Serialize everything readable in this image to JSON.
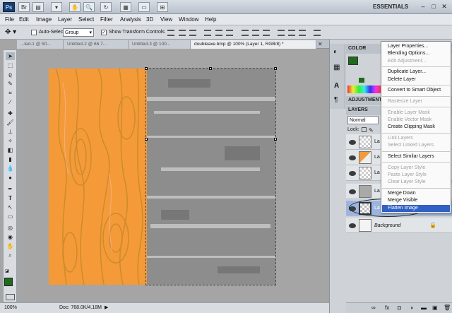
{
  "app": {
    "logo": "Ps",
    "workspace": "ESSENTIALS",
    "window_controls": [
      "–",
      "□",
      "✕"
    ]
  },
  "menubar": {
    "items": [
      "File",
      "Edit",
      "Image",
      "Layer",
      "Select",
      "Filter",
      "Analysis",
      "3D",
      "View",
      "Window",
      "Help"
    ]
  },
  "options": {
    "auto_select_label": "Auto-Select:",
    "auto_select_value": "Group",
    "transform_label": "Show Transform Controls"
  },
  "tabs": [
    {
      "label": "...led-1 @ 50...",
      "active": false
    },
    {
      "label": "Untitled-2 @ 66.7...",
      "active": false
    },
    {
      "label": "Untitled-3 @ 100...",
      "active": false
    },
    {
      "label": "doubleaxe.bmp @ 100% (Layer 1, RGB/8) *",
      "active": true
    }
  ],
  "status": {
    "zoom": "100%",
    "doc": "Doc: 768.0K/4.18M"
  },
  "panels": {
    "color_tab": "COLOR",
    "adjustments_tab": "ADJUSTMENT",
    "layers_tab": "LAYERS",
    "blend_mode": "Normal",
    "lock_label": "Lock:",
    "layer_prefix": "La",
    "background_label": "Background"
  },
  "context_menu": {
    "groups": [
      [
        {
          "label": "Layer Properties...",
          "enabled": true
        },
        {
          "label": "Blending Options...",
          "enabled": true
        },
        {
          "label": "Edit Adjustment...",
          "enabled": false
        }
      ],
      [
        {
          "label": "Duplicate Layer...",
          "enabled": true
        },
        {
          "label": "Delete Layer",
          "enabled": true
        }
      ],
      [
        {
          "label": "Convert to Smart Object",
          "enabled": true
        }
      ],
      [
        {
          "label": "Rasterize Layer",
          "enabled": false
        }
      ],
      [
        {
          "label": "Enable Layer Mask",
          "enabled": false
        },
        {
          "label": "Enable Vector Mask",
          "enabled": false
        },
        {
          "label": "Create Clipping Mask",
          "enabled": true
        }
      ],
      [
        {
          "label": "Link Layers",
          "enabled": false
        },
        {
          "label": "Select Linked Layers",
          "enabled": false
        }
      ],
      [
        {
          "label": "Select Similar Layers",
          "enabled": true
        }
      ],
      [
        {
          "label": "Copy Layer Style",
          "enabled": false
        },
        {
          "label": "Paste Layer Style",
          "enabled": false
        },
        {
          "label": "Clear Layer Style",
          "enabled": false
        }
      ],
      [
        {
          "label": "Merge Down",
          "enabled": true
        },
        {
          "label": "Merge Visible",
          "enabled": true
        },
        {
          "label": "Flatten Image",
          "enabled": true,
          "highlighted": true
        }
      ]
    ]
  },
  "colors": {
    "accent": "#3161c5",
    "foreground_swatch": "#1f6a1d",
    "orange": "#f49a39"
  },
  "icons": [
    "photoshop-logo-icon",
    "move-tool-icon",
    "eye-icon",
    "lock-icon"
  ]
}
